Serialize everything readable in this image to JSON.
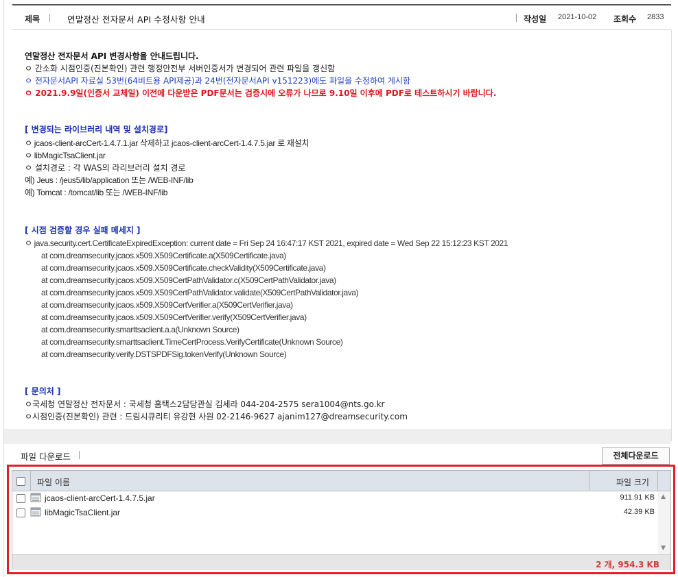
{
  "header": {
    "subject_label": "제목",
    "title": "연말정산 전자문서 API 수정사항 안내",
    "date_label": "작성일",
    "date": "2021-10-02",
    "views_label": "조회수",
    "views": "2833"
  },
  "body": {
    "intro": "연말정산 전자문서 API 변경사항을 안내드립니다.",
    "bullets": [
      "ㅇ 간소화 시점인증(진본확인) 관련 행정안전부 서버인증서가 변경되어 관련 파일을 갱신함",
      "ㅇ 전자문서API 자료실 53번(64비트용 API제공)과 24번(전자문서API v151223)에도 파일을 수정하여 게시함",
      "ㅇ 2021.9.9일(인증서 교체일) 이전에 다운받은 PDF문서는 검증시에 오류가 나므로 9.10일 이후에 PDF로 테스트하시기 바랍니다."
    ],
    "section1_title": "[ 변경되는 라이브러리 내역 및 설치경로]",
    "section1_lines": [
      "ㅇ jcaos-client-arcCert-1.4.7.1.jar  삭제하고  jcaos-client-arcCert-1.4.7.5.jar 로  재설치",
      "ㅇ libMagicTsaClient.jar",
      "ㅇ 설치경로 : 각 WAS의 라리브러리 설치 경로",
      "     예)  Jeus : /jeus5/lib/application 또는 /WEB-INF/lib",
      "     예)   Tomcat : /tomcat/lib 또는 /WEB-INF/lib"
    ],
    "section2_title": "[ 시점 검증할 경우 실패 메세지 ]",
    "section2_first": "ㅇ java.security.cert.CertificateExpiredException: current date = Fri Sep 24 16:47:17 KST 2021, expired date = Wed Sep 22 15:12:23 KST 2021",
    "section2_trace": [
      "at com.dreamsecurity.jcaos.x509.X509Certificate.a(X509Certificate.java)",
      "at com.dreamsecurity.jcaos.x509.X509Certificate.checkValidity(X509Certificate.java)",
      "at com.dreamsecurity.jcaos.x509.X509CertPathValidator.c(X509CertPathValidator.java)",
      "at com.dreamsecurity.jcaos.x509.X509CertPathValidator.validate(X509CertPathValidator.java)",
      "at com.dreamsecurity.jcaos.x509.X509CertVerifier.a(X509CertVerifier.java)",
      "at com.dreamsecurity.jcaos.x509.X509CertVerifier.verify(X509CertVerifier.java)",
      "at com.dreamsecurity.smarttsaclient.a.a(Unknown Source)",
      "at com.dreamsecurity.smarttsaclient.TimeCertProcess.VerifyCertificate(Unknown Source)",
      "at com.dreamsecurity.verify.DSTSPDFSig.tokenVerify(Unknown Source)"
    ],
    "section3_title": "[ 문의처 ]",
    "section3_lines": [
      "ㅇ국세청 연말정산 전자문서   : 국세청 홈택스2담당관실 김세라  044-204-2575 sera1004@nts.go.kr",
      "ㅇ시점인증(진본확인) 관련    : 드림시큐리티 유강현 사원  02-2146-9627  ajanim127@dreamsecurity.com"
    ]
  },
  "download": {
    "title": "파일 다운로드",
    "all_button": "전체다운로드",
    "col_name": "파일 이름",
    "col_size": "파일 크기",
    "files": [
      {
        "name": "jcaos-client-arcCert-1.4.7.5.jar",
        "size": "911.91 KB"
      },
      {
        "name": "libMagicTsaClient.jar",
        "size": "42.39 KB"
      }
    ],
    "total": "2 개,  954.3 KB"
  },
  "colors": {
    "accent_blue": "#1a2fb3",
    "warning_red": "#e0141b",
    "highlight_box": "#e41e26"
  }
}
